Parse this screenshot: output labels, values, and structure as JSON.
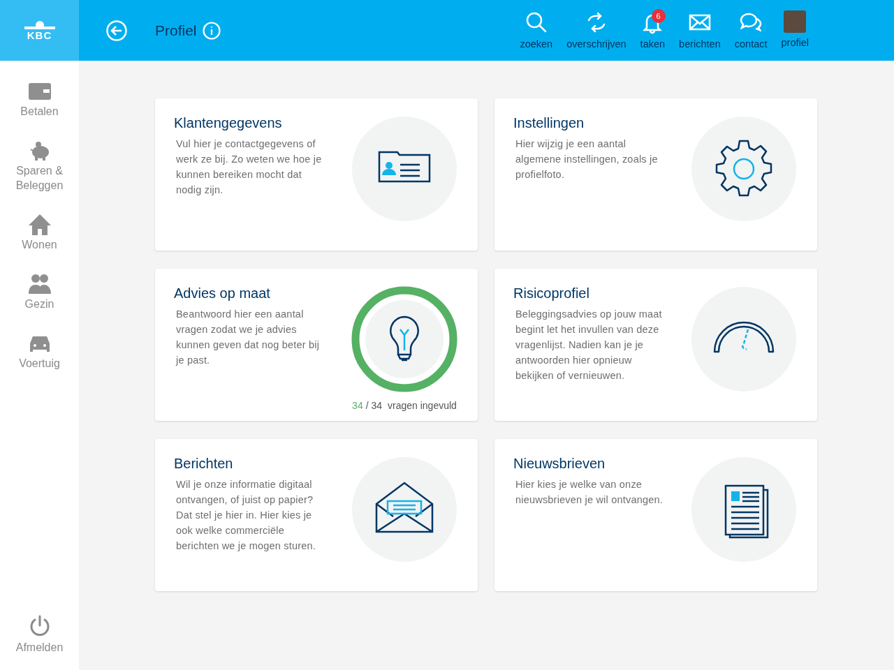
{
  "logo": {
    "text": "KBC"
  },
  "header": {
    "title": "Profiel"
  },
  "toolbar": [
    {
      "kind": "search",
      "label": "zoeken"
    },
    {
      "kind": "transfer",
      "label": "overschrijven"
    },
    {
      "kind": "bell",
      "label": "taken",
      "badge": "6"
    },
    {
      "kind": "mail",
      "label": "berichten"
    },
    {
      "kind": "chat",
      "label": "contact"
    },
    {
      "kind": "avatar",
      "label": "profiel"
    }
  ],
  "sidebar": {
    "items": [
      {
        "kind": "wallet",
        "label": "Betalen"
      },
      {
        "kind": "piggy",
        "label": "Sparen & Beleggen"
      },
      {
        "kind": "house",
        "label": "Wonen"
      },
      {
        "kind": "people",
        "label": "Gezin"
      },
      {
        "kind": "car",
        "label": "Voertuig"
      }
    ],
    "logout": {
      "label": "Afmelden"
    }
  },
  "cards": [
    {
      "kind": "id",
      "title": "Klantengegevens",
      "text": "Vul hier je contactgegevens of werk ze bij. Zo weten we hoe je kunnen bereiken mocht dat nodig zijn."
    },
    {
      "kind": "gear",
      "title": "Instellingen",
      "text": "Hier wijzig je een aantal algemene instellingen, zoals je profielfoto."
    },
    {
      "kind": "bulb",
      "title": "Advies op maat",
      "text": "Beantwoord hier een aantal vragen zodat we je advies kunnen geven dat nog beter bij je past.",
      "progress": {
        "level": 1,
        "done": "34",
        "total": "/ 34",
        "label": "vragen ingevuld"
      }
    },
    {
      "kind": "gauge",
      "title": "Risicoprofiel",
      "text": "Beleggingsadvies op jouw maat begint let het invullen van deze vragenlijst. Nadien kan je je antwoorden hier opnieuw bekijken of vernieuwen."
    },
    {
      "kind": "envelope",
      "title": "Berichten",
      "text": "Wil je onze informatie digitaal ontvangen, of juist op papier? Dat stel je hier in. Hier kies je ook welke commerciële berichten we je mogen sturen."
    },
    {
      "kind": "newspaper",
      "title": "Nieuwsbrieven",
      "text": "Hier kies je welke van onze nieuwsbrieven je wil ontvangen."
    }
  ]
}
